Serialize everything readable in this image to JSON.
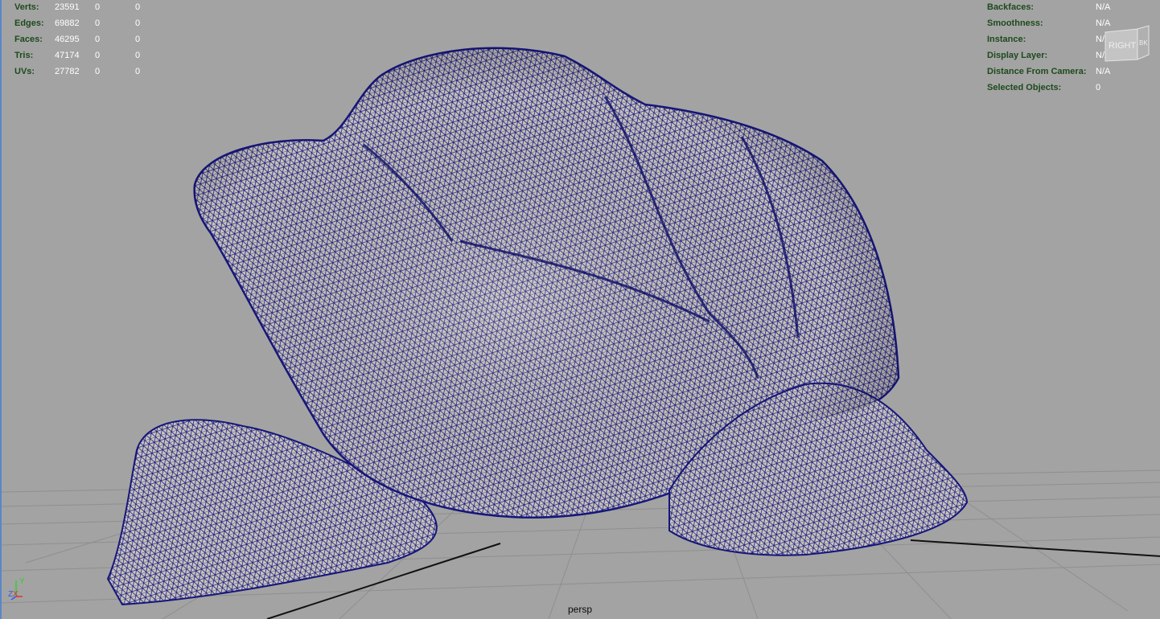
{
  "hud_left": {
    "rows": [
      {
        "label": "Verts:",
        "total": "23591",
        "selected": "0",
        "uv": "0"
      },
      {
        "label": "Edges:",
        "total": "69882",
        "selected": "0",
        "uv": "0"
      },
      {
        "label": "Faces:",
        "total": "46295",
        "selected": "0",
        "uv": "0"
      },
      {
        "label": "Tris:",
        "total": "47174",
        "selected": "0",
        "uv": "0"
      },
      {
        "label": "UVs:",
        "total": "27782",
        "selected": "0",
        "uv": "0"
      }
    ]
  },
  "hud_right": {
    "rows": [
      {
        "label": "Backfaces:",
        "value": "N/A"
      },
      {
        "label": "Smoothness:",
        "value": "N/A"
      },
      {
        "label": "Instance:",
        "value": "N/A"
      },
      {
        "label": "Display Layer:",
        "value": "N/A"
      },
      {
        "label": "Distance From Camera:",
        "value": "N/A"
      },
      {
        "label": "Selected Objects:",
        "value": "0"
      }
    ]
  },
  "viewcube": {
    "face_label": "RIGHT",
    "side_label": "BK"
  },
  "camera": {
    "name": "persp"
  },
  "axis_gizmo": {
    "x": "X",
    "y": "Y",
    "z": "Z"
  },
  "colors": {
    "background": "#a3a3a3",
    "grid": "#8f8f8f",
    "wireframe": "#16167a",
    "mesh_fill": "#c8c4ba",
    "hud_label": "#1d4a1d",
    "hud_value": "#ffffff"
  },
  "icons": [
    "viewcube-icon",
    "axis-gizmo-icon"
  ]
}
